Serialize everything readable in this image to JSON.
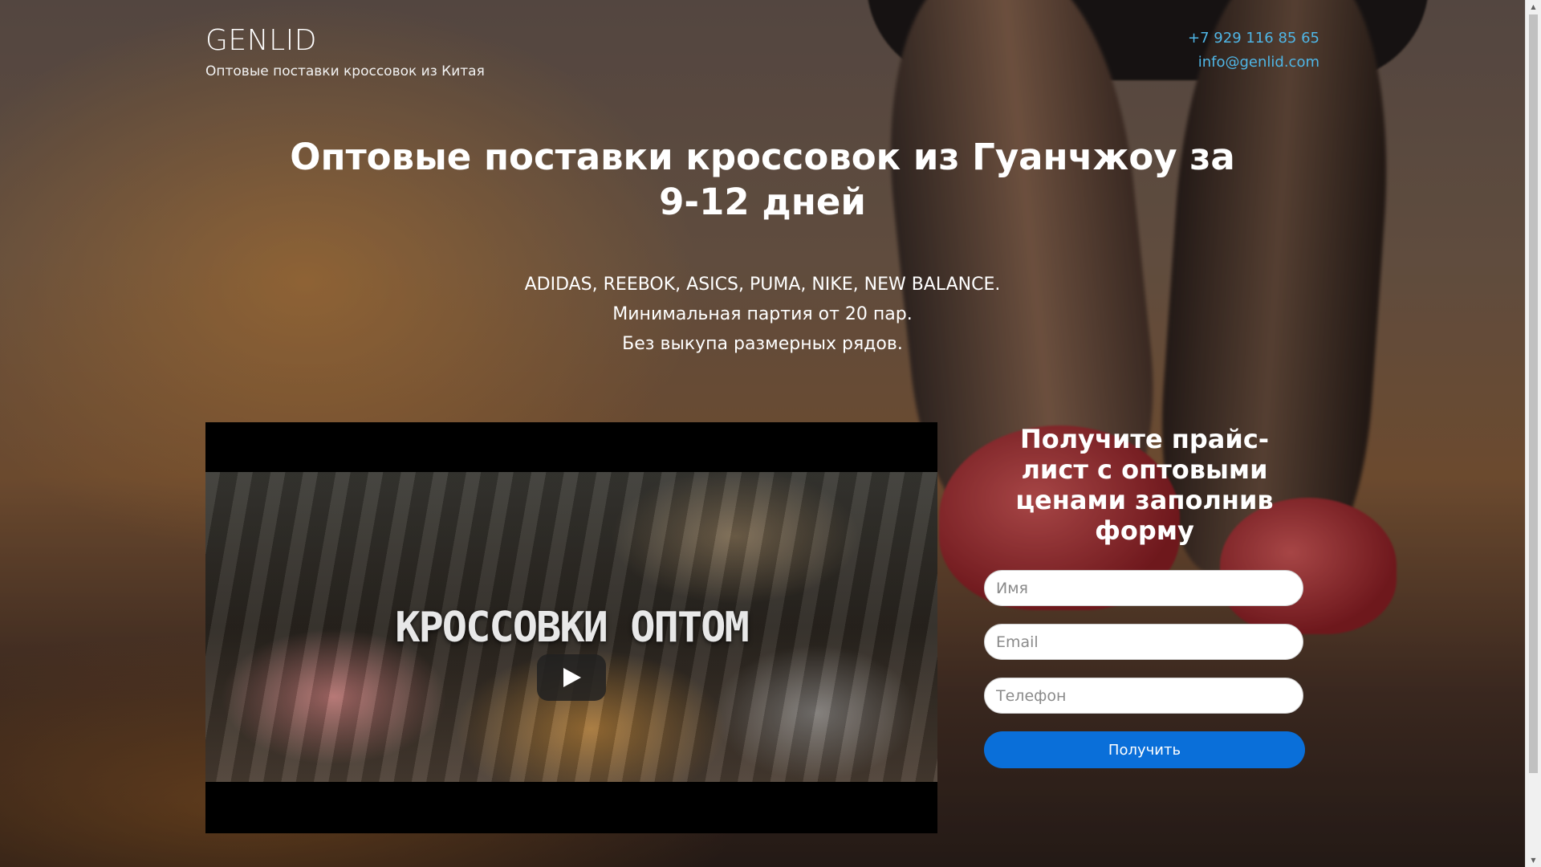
{
  "brand": {
    "name": "GENLID",
    "tagline": "Оптовые поставки кроссовок из Китая"
  },
  "contacts": {
    "phone": "+7 929 116 85 65",
    "email": "info@genlid.com"
  },
  "hero": {
    "title": "Оптовые поставки кроссовок из Гуанчжоу за 9-12 дней",
    "lines": [
      "ADIDAS, REEBOK, ASICS, PUMA, NIKE, NEW BALANCE.",
      "Минимальная партия от 20 пар.",
      "Без выкупа размерных рядов."
    ]
  },
  "video": {
    "caption": "КРОССОВКИ ОПТОМ",
    "play_icon": "play-icon"
  },
  "form": {
    "title": "Получите прайс-лист с оптовыми ценами заполнив форму",
    "name_placeholder": "Имя",
    "email_placeholder": "Email",
    "phone_placeholder": "Телефон",
    "submit_label": "Получить"
  },
  "colors": {
    "link": "#4fb6e6",
    "button": "#0a6fd9"
  }
}
